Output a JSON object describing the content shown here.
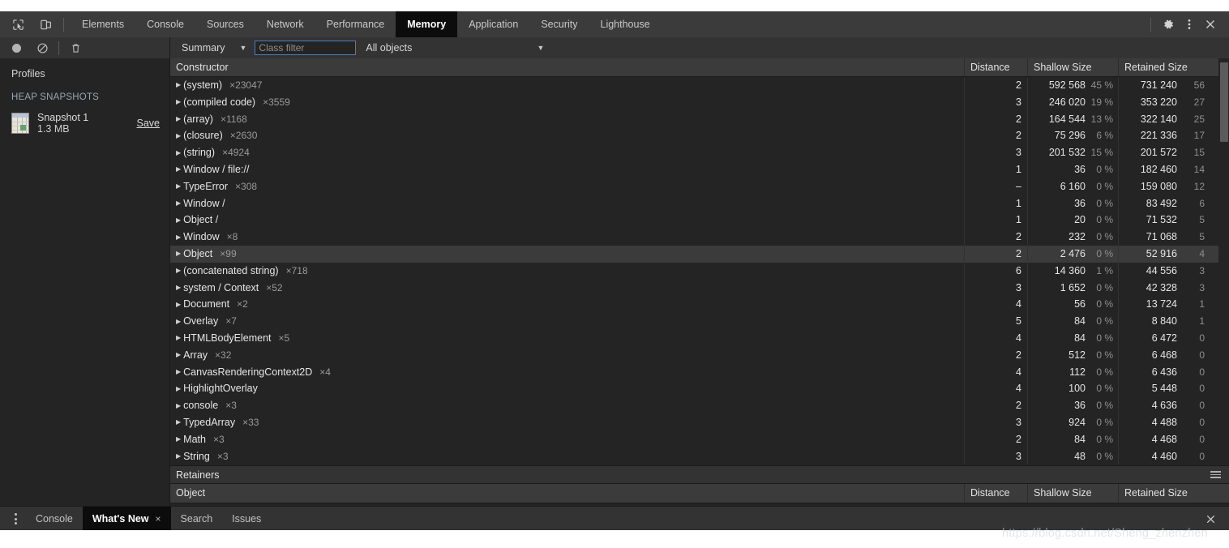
{
  "window": {
    "device_toolbar_icons": [
      "inspect-element-icon",
      "device-toolbar-icon"
    ],
    "right_icons": [
      "gear-icon",
      "more-options-icon",
      "close-icon"
    ]
  },
  "tabs": [
    {
      "label": "Elements",
      "active": false
    },
    {
      "label": "Console",
      "active": false
    },
    {
      "label": "Sources",
      "active": false
    },
    {
      "label": "Network",
      "active": false
    },
    {
      "label": "Performance",
      "active": false
    },
    {
      "label": "Memory",
      "active": true
    },
    {
      "label": "Application",
      "active": false
    },
    {
      "label": "Security",
      "active": false
    },
    {
      "label": "Lighthouse",
      "active": false
    }
  ],
  "toolbar": {
    "record_icon": "record-icon",
    "clear_icon": "clear-icon",
    "trash_icon": "trash-icon",
    "view_selector": "Summary",
    "class_filter_value": "",
    "class_filter_placeholder": "Class filter",
    "objects_selector": "All objects",
    "caret": "▼"
  },
  "sidebar": {
    "title": "Profiles",
    "section": "HEAP SNAPSHOTS",
    "snapshot": {
      "name": "Snapshot 1",
      "size": "1.3 MB",
      "save_label": "Save",
      "icon": "heap-snapshot-icon"
    }
  },
  "table": {
    "columns": [
      "Constructor",
      "Distance",
      "Shallow Size",
      "Retained Size"
    ],
    "rows": [
      {
        "ctor": "(system)",
        "count": "×23047",
        "distance": "2",
        "shallow": "592 568",
        "shallow_pct": "45 %",
        "retained": "731 240",
        "retained_pct": "56",
        "selected": false
      },
      {
        "ctor": "(compiled code)",
        "count": "×3559",
        "distance": "3",
        "shallow": "246 020",
        "shallow_pct": "19 %",
        "retained": "353 220",
        "retained_pct": "27",
        "selected": false
      },
      {
        "ctor": "(array)",
        "count": "×1168",
        "distance": "2",
        "shallow": "164 544",
        "shallow_pct": "13 %",
        "retained": "322 140",
        "retained_pct": "25",
        "selected": false
      },
      {
        "ctor": "(closure)",
        "count": "×2630",
        "distance": "2",
        "shallow": "75 296",
        "shallow_pct": "6 %",
        "retained": "221 336",
        "retained_pct": "17",
        "selected": false
      },
      {
        "ctor": "(string)",
        "count": "×4924",
        "distance": "3",
        "shallow": "201 532",
        "shallow_pct": "15 %",
        "retained": "201 572",
        "retained_pct": "15",
        "selected": false
      },
      {
        "ctor": "Window / file://",
        "count": "",
        "distance": "1",
        "shallow": "36",
        "shallow_pct": "0 %",
        "retained": "182 460",
        "retained_pct": "14",
        "selected": false
      },
      {
        "ctor": "TypeError",
        "count": "×308",
        "distance": "–",
        "shallow": "6 160",
        "shallow_pct": "0 %",
        "retained": "159 080",
        "retained_pct": "12",
        "selected": false
      },
      {
        "ctor": "Window /",
        "count": "",
        "distance": "1",
        "shallow": "36",
        "shallow_pct": "0 %",
        "retained": "83 492",
        "retained_pct": "6",
        "selected": false
      },
      {
        "ctor": "Object /",
        "count": "",
        "distance": "1",
        "shallow": "20",
        "shallow_pct": "0 %",
        "retained": "71 532",
        "retained_pct": "5",
        "selected": false
      },
      {
        "ctor": "Window",
        "count": "×8",
        "distance": "2",
        "shallow": "232",
        "shallow_pct": "0 %",
        "retained": "71 068",
        "retained_pct": "5",
        "selected": false
      },
      {
        "ctor": "Object",
        "count": "×99",
        "distance": "2",
        "shallow": "2 476",
        "shallow_pct": "0 %",
        "retained": "52 916",
        "retained_pct": "4",
        "selected": true
      },
      {
        "ctor": "(concatenated string)",
        "count": "×718",
        "distance": "6",
        "shallow": "14 360",
        "shallow_pct": "1 %",
        "retained": "44 556",
        "retained_pct": "3",
        "selected": false
      },
      {
        "ctor": "system / Context",
        "count": "×52",
        "distance": "3",
        "shallow": "1 652",
        "shallow_pct": "0 %",
        "retained": "42 328",
        "retained_pct": "3",
        "selected": false
      },
      {
        "ctor": "Document",
        "count": "×2",
        "distance": "4",
        "shallow": "56",
        "shallow_pct": "0 %",
        "retained": "13 724",
        "retained_pct": "1",
        "selected": false
      },
      {
        "ctor": "Overlay",
        "count": "×7",
        "distance": "5",
        "shallow": "84",
        "shallow_pct": "0 %",
        "retained": "8 840",
        "retained_pct": "1",
        "selected": false
      },
      {
        "ctor": "HTMLBodyElement",
        "count": "×5",
        "distance": "4",
        "shallow": "84",
        "shallow_pct": "0 %",
        "retained": "6 472",
        "retained_pct": "0",
        "selected": false
      },
      {
        "ctor": "Array",
        "count": "×32",
        "distance": "2",
        "shallow": "512",
        "shallow_pct": "0 %",
        "retained": "6 468",
        "retained_pct": "0",
        "selected": false
      },
      {
        "ctor": "CanvasRenderingContext2D",
        "count": "×4",
        "distance": "4",
        "shallow": "112",
        "shallow_pct": "0 %",
        "retained": "6 436",
        "retained_pct": "0",
        "selected": false
      },
      {
        "ctor": "HighlightOverlay",
        "count": "",
        "distance": "4",
        "shallow": "100",
        "shallow_pct": "0 %",
        "retained": "5 448",
        "retained_pct": "0",
        "selected": false
      },
      {
        "ctor": "console",
        "count": "×3",
        "distance": "2",
        "shallow": "36",
        "shallow_pct": "0 %",
        "retained": "4 636",
        "retained_pct": "0",
        "selected": false
      },
      {
        "ctor": "TypedArray",
        "count": "×33",
        "distance": "3",
        "shallow": "924",
        "shallow_pct": "0 %",
        "retained": "4 488",
        "retained_pct": "0",
        "selected": false
      },
      {
        "ctor": "Math",
        "count": "×3",
        "distance": "2",
        "shallow": "84",
        "shallow_pct": "0 %",
        "retained": "4 468",
        "retained_pct": "0",
        "selected": false
      },
      {
        "ctor": "String",
        "count": "×3",
        "distance": "3",
        "shallow": "48",
        "shallow_pct": "0 %",
        "retained": "4 460",
        "retained_pct": "0",
        "selected": false
      }
    ]
  },
  "retainers": {
    "title": "Retainers",
    "menu_icon": "hamburger-menu-icon",
    "columns": [
      "Object",
      "Distance",
      "Shallow Size",
      "Retained Size"
    ]
  },
  "drawer": {
    "more_icon": "more-tabs-icon",
    "tabs": [
      {
        "label": "Console",
        "active": false,
        "closable": false
      },
      {
        "label": "What's New",
        "active": true,
        "closable": true,
        "close": "×"
      },
      {
        "label": "Search",
        "active": false,
        "closable": false
      },
      {
        "label": "Issues",
        "active": false,
        "closable": false
      }
    ],
    "close_icon": "close-drawer-icon"
  },
  "watermark": "https://blog.csdn.net/Sheng_zhenzhen"
}
